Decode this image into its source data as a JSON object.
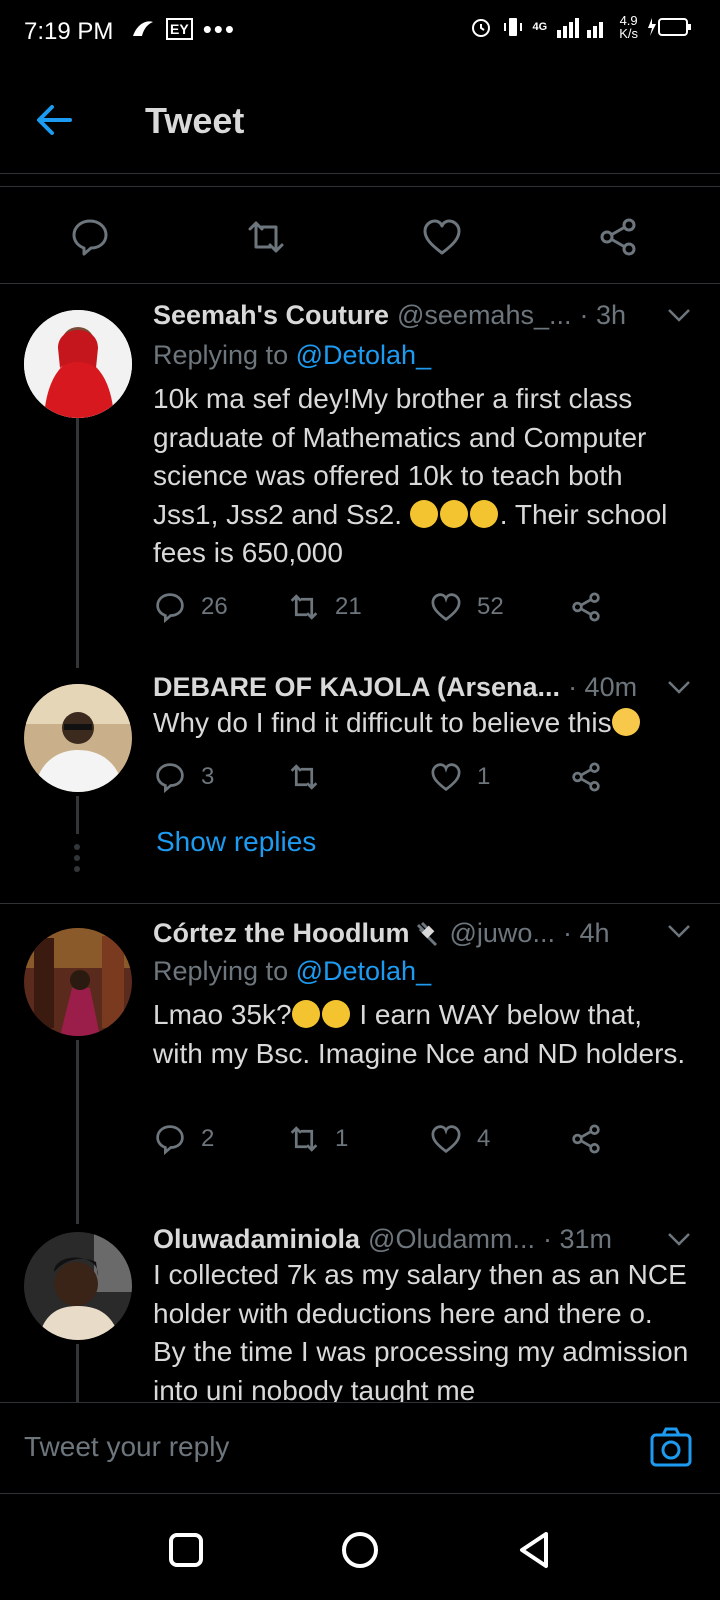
{
  "status_bar": {
    "time": "7:19 PM",
    "ey": "EY",
    "dots": "•••",
    "network": "4G",
    "speed_value": "4.9",
    "speed_unit": "K/s"
  },
  "header": {
    "title": "Tweet",
    "back_icon": "arrow-left-icon"
  },
  "main_actions": [
    "reply-icon",
    "retweet-icon",
    "like-icon",
    "share-icon"
  ],
  "replies": [
    {
      "name": "Seemah's Couture",
      "handle": "@seemahs_...",
      "time": "· 3h",
      "replying_prefix": "Replying to ",
      "replying_to": "@Detolah_",
      "text_part1": "10k ma sef dey!My brother a first class graduate of Mathematics and Computer science was offered 10k to teach both Jss1, Jss2 and Ss2. ",
      "text_part2": ". Their school fees is 650,000",
      "reply_count": "26",
      "retweet_count": "21",
      "like_count": "52"
    },
    {
      "name": "DEBARE OF KAJOLA (Arsena...",
      "time": "· 40m",
      "text": "Why do I find it difficult to believe this",
      "reply_count": "3",
      "retweet_count": "",
      "like_count": "1",
      "show_replies": "Show replies"
    },
    {
      "name": "Córtez the Hoodlum",
      "handle": "@juwo...",
      "time": "· 4h",
      "replying_prefix": "Replying to ",
      "replying_to": "@Detolah_",
      "text_part1": "Lmao 35k?",
      "text_part2": " I earn WAY below that, with my Bsc. Imagine Nce and ND holders.",
      "reply_count": "2",
      "retweet_count": "1",
      "like_count": "4"
    },
    {
      "name": "Oluwadaminiola",
      "handle": "@Oludamm...",
      "time": "· 31m",
      "text": "I collected 7k as my salary then as an NCE holder with deductions here and there o. By the time I was processing my admission into uni nobody taught me"
    }
  ],
  "composer": {
    "placeholder": "Tweet your reply"
  },
  "navbar": [
    "square-recents-icon",
    "circle-home-icon",
    "triangle-back-icon"
  ],
  "colors": {
    "background": "#000000",
    "accent": "#1d9bf0",
    "text": "#d9d9d9",
    "muted": "#6e767d",
    "divider": "#2f3336"
  }
}
